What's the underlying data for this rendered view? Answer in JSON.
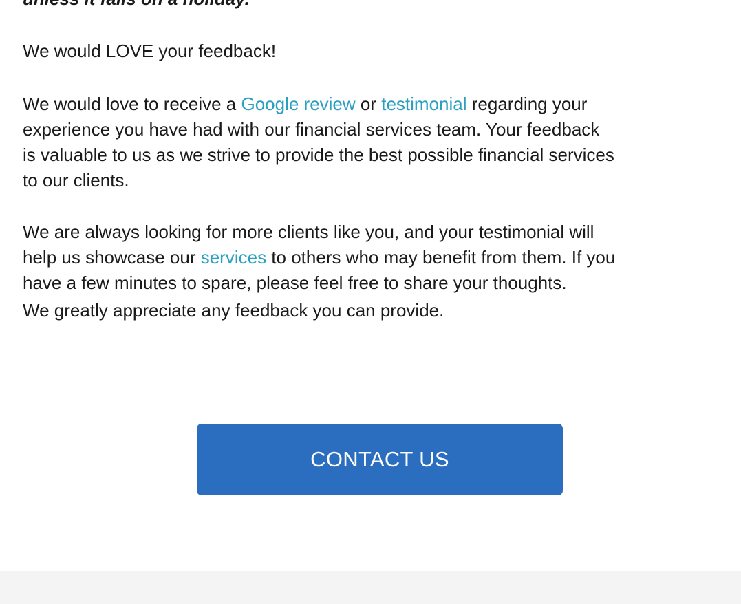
{
  "notice": {
    "italic_line": "unless it falls on a holiday."
  },
  "feedback": {
    "heading": "We would LOVE your feedback!",
    "para1": {
      "prefix": " We would love to receive a ",
      "google_review_link": "Google review",
      "or_text": " or ",
      "testimonial_link": "testimonial",
      "line1_suffix": " regarding your",
      "line2": "experience you have had with our financial services team. Your feedback",
      "line3": "is valuable to us as we strive to provide the best possible financial services",
      "line4": "to our clients."
    },
    "para2": {
      "line1": "We are always looking for more clients like you, and your testimonial will",
      "line2_prefix": "help us showcase our ",
      "services_link": "services",
      "line2_suffix": " to others who may benefit from them. If you",
      "line3": "have a few minutes to spare, please feel free to share your thoughts."
    },
    "para3": "We greatly appreciate any feedback you can provide."
  },
  "cta": {
    "label": "CONTACT US",
    "color": "#2b6ebf"
  },
  "colors": {
    "link": "#2a9fc0",
    "text": "#1a1a1a",
    "footer": "#f4f4f4"
  }
}
